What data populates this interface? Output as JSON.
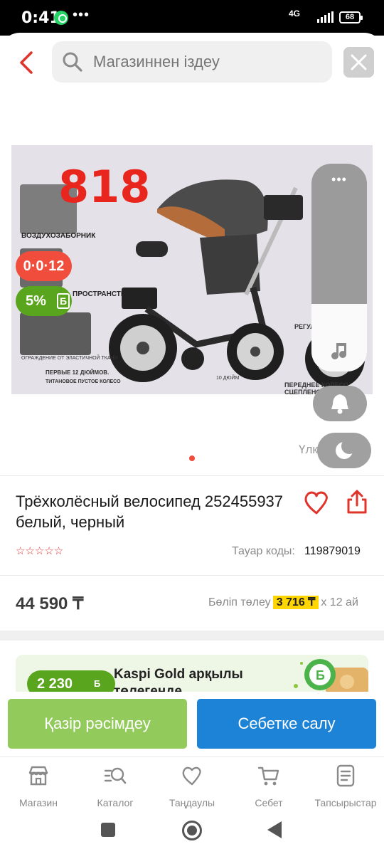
{
  "status_bar": {
    "time": "0:41",
    "network": "4G",
    "battery": "68"
  },
  "search": {
    "placeholder": "Магазиннен іздеу"
  },
  "product_image": {
    "number_text": "818",
    "labels": [
      "ВОЗДУХОЗАБОРНИК",
      "ПРОСТРАНСТВО.",
      "ОГРАЖДЕНИЕ ОТ ЭЛАСТИЧНОЙ ТКАНИ",
      "ПЕРВЫЕ 12 ДЮЙМОВ.",
      "ТИТАНОВОЕ ПУСТОЕ КОЛЕСО",
      "10 ДЮЙМ",
      "РЕГУЛ",
      "ПЕРЕДНЕЕ КОЛЕСО СЦЕПЛЕНО"
    ],
    "timer_badge": "0·0·12",
    "bonus_badge": "5%",
    "bonus_symbol": "Б"
  },
  "overlay": {
    "partial_text": "Үлк"
  },
  "product": {
    "title": "Трёхколёсный велосипед 252455937 белый, черный",
    "rating_stars": "☆☆☆☆☆",
    "code_label": "Тауар коды:",
    "code_value": "119879019",
    "price": "44 590 ₸",
    "installment_label": "Бөліп төлеу",
    "installment_monthly": "3 716 ₸",
    "installment_term": "x 12 ай"
  },
  "kaspi_gold": {
    "bonus": "2 230",
    "bonus_symbol": "Б",
    "text_line1": "Kaspi Gold арқылы",
    "text_line2": "төлегенде"
  },
  "actions": {
    "buy_now": "Қазір рәсімдеу",
    "add_to_cart": "Себетке салу"
  },
  "tabs": [
    {
      "label": "Магазин",
      "icon": "store-icon"
    },
    {
      "label": "Каталог",
      "icon": "catalog-search-icon"
    },
    {
      "label": "Таңдаулы",
      "icon": "heart-icon"
    },
    {
      "label": "Себет",
      "icon": "cart-icon"
    },
    {
      "label": "Тапсырыстар",
      "icon": "orders-icon"
    }
  ],
  "colors": {
    "accent_red": "#f14d3d",
    "buy_green": "#92cb5c",
    "cart_blue": "#1d83d6",
    "bonus_green": "#5aa51e",
    "installment_yellow": "#ffd600"
  }
}
